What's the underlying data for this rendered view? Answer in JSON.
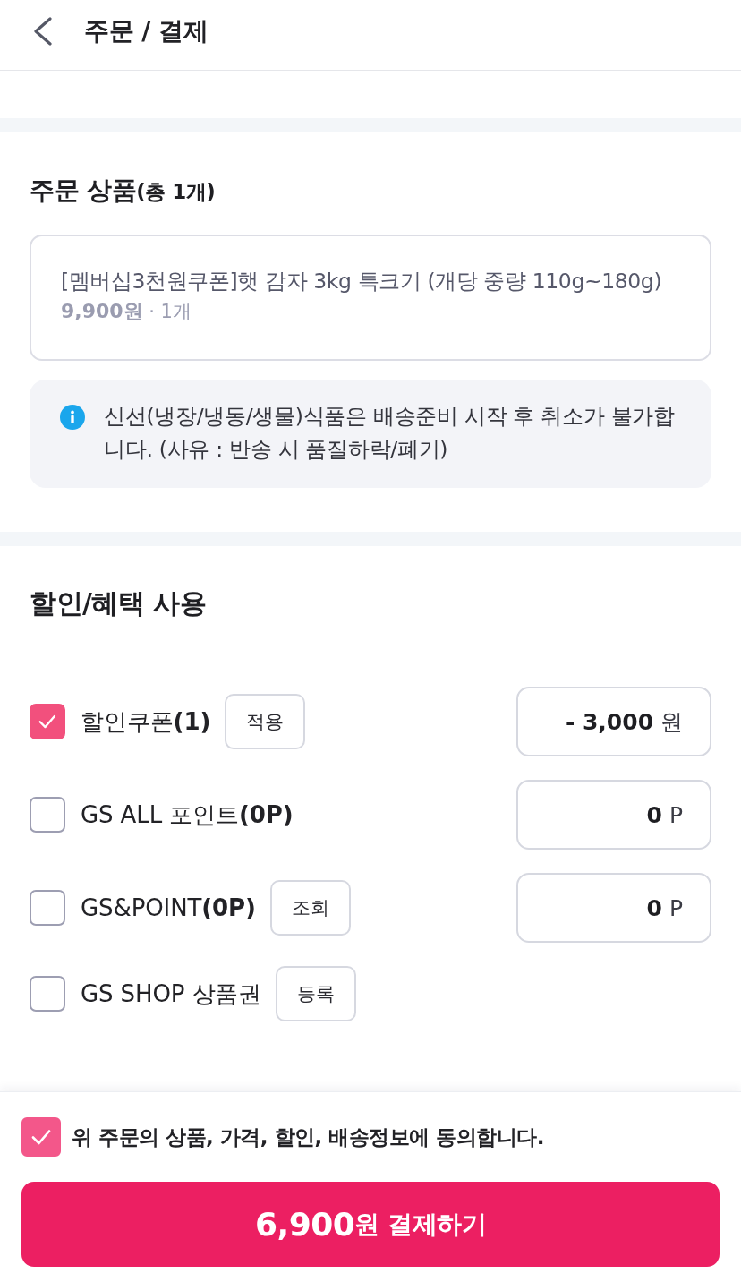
{
  "header": {
    "title": "주문 / 결제"
  },
  "order_items": {
    "title": "주문 상품",
    "count": "(총 1개)",
    "items": [
      {
        "name": "[멤버십3천원쿠폰]햇 감자 3kg 특크기 (개당 중량 110g~180g)",
        "price": "**9,900원** · 1개"
      }
    ],
    "notice": "신선(냉장/냉동/생물)식품은 배송준비 시작 후 취소가 불가합니다. (사유 : 반송 시 품질하락/폐기)"
  },
  "benefits": {
    "title": "할인/혜택 사용",
    "items": [
      {
        "label": "할인쿠폰**(1)**",
        "checked": true,
        "button": "적용",
        "amount": "**- 3,000** 원"
      },
      {
        "label": "GS ALL 포인트**(0P)**",
        "checked": false,
        "amount": "**0** P"
      },
      {
        "label": "GS&POINT**(0P)**",
        "checked": false,
        "button": "조회",
        "amount": "**0** P"
      },
      {
        "label": "GS SHOP 상품권",
        "checked": false,
        "button": "등록"
      }
    ]
  },
  "agreement": {
    "text": "위 주문의 상품, 가격, 할인, 배송정보에 동의합니다.",
    "checked": true
  },
  "pay_button": {
    "label": "**6,900**원 결제하기"
  }
}
